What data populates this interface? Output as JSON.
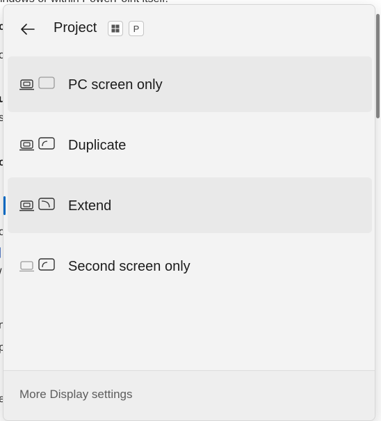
{
  "background": {
    "top_text": "indows or within PowerPoint itself:",
    "fragments": [
      "u",
      "s",
      "o",
      "o",
      "/",
      "n",
      "p",
      "e"
    ]
  },
  "flyout": {
    "title": "Project",
    "shortcut_keys": [
      "⊞",
      "P"
    ],
    "options": [
      {
        "label": "PC screen only",
        "state": "hover"
      },
      {
        "label": "Duplicate",
        "state": "normal"
      },
      {
        "label": "Extend",
        "state": "selected"
      },
      {
        "label": "Second screen only",
        "state": "normal"
      }
    ],
    "footer_link": "More Display settings"
  },
  "colors": {
    "accent": "#0067c0",
    "panel_bg": "#f3f3f3",
    "hover_bg": "#e9e9e9"
  }
}
